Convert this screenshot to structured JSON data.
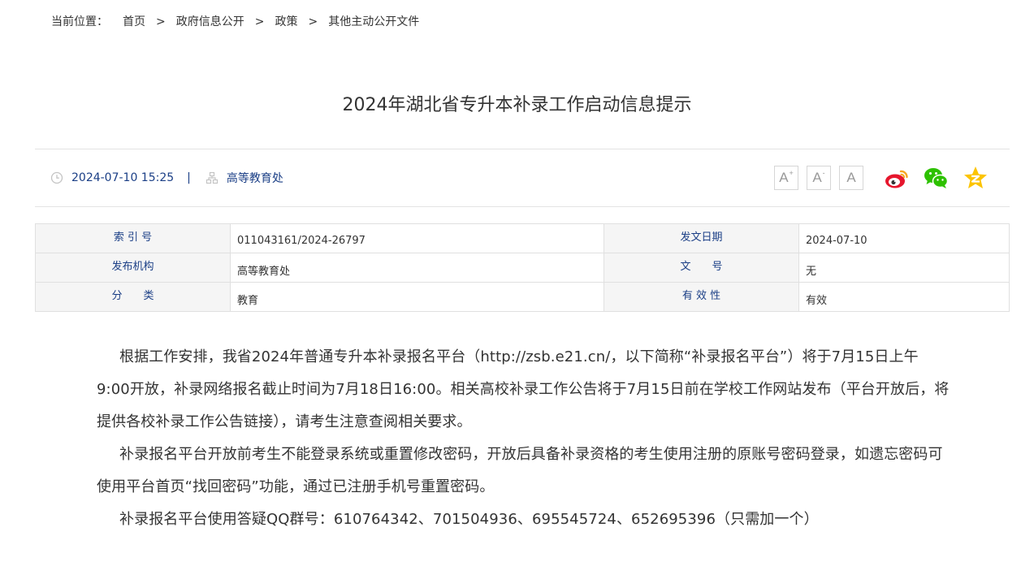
{
  "breadcrumb": {
    "label": "当前位置：",
    "items": [
      "首页",
      "政府信息公开",
      "政策",
      "其他主动公开文件"
    ],
    "separator": ">"
  },
  "article": {
    "title": "2024年湖北省专升本补录工作启动信息提示",
    "datetime": "2024-07-10 15:25",
    "pipe": "|",
    "department": "高等教育处"
  },
  "font_controls": {
    "increase": "A",
    "increase_mark": "+",
    "decrease": "A",
    "decrease_mark": "-",
    "reset": "A"
  },
  "share": {
    "icons": [
      "weibo-icon",
      "wechat-icon",
      "qzone-icon"
    ]
  },
  "info_table": {
    "index_label": "索 引 号",
    "index_value": "011043161/2024-26797",
    "date_label": "发文日期",
    "date_value": "2024-07-10",
    "publisher_label": "发布机构",
    "publisher_value": "高等教育处",
    "docno_label": "文　　号",
    "docno_value": "无",
    "category_label": "分　　类",
    "category_value": "教育",
    "validity_label": "有 效 性",
    "validity_value": "有效"
  },
  "content": {
    "paragraphs": [
      "根据工作安排，我省2024年普通专升本补录报名平台（http://zsb.e21.cn/，以下简称“补录报名平台”）将于7月15日上午9:00开放，补录网络报名截止时间为7月18日16:00。相关高校补录工作公告将于7月15日前在学校工作网站发布（平台开放后，将提供各校补录工作公告链接），请考生注意查阅相关要求。",
      "补录报名平台开放前考生不能登录系统或重置修改密码，开放后具备补录资格的考生使用注册的原账号密码登录，如遗忘密码可使用平台首页“找回密码”功能，通过已注册手机号重置密码。",
      "补录报名平台使用答疑QQ群号：610764342、701504936、695545724、652695396（只需加一个）"
    ]
  },
  "colors": {
    "link": "#1b3f86",
    "text": "#333333",
    "border": "#e0e0e0",
    "label_bg": "#f5f5f5",
    "weibo": "#e6162d",
    "wechat": "#2dc100",
    "qzone": "#fcc400"
  }
}
